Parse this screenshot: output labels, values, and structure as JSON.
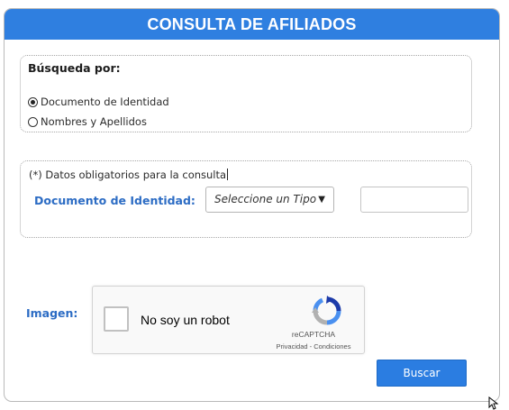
{
  "header": {
    "title": "CONSULTA DE AFILIADOS"
  },
  "search": {
    "legend": "Búsqueda por:",
    "options": [
      {
        "label": "Documento de Identidad",
        "checked": true
      },
      {
        "label": "Nombres y Apellidos",
        "checked": false
      }
    ]
  },
  "document": {
    "required_note": "(*) Datos obligatorios para la consulta",
    "label": "Documento de Identidad:",
    "type_select": {
      "value": "Seleccione un Tipo",
      "arrow": "▼"
    },
    "number_value": ""
  },
  "captcha": {
    "label": "Imagen:",
    "checkbox_text": "No soy un robot",
    "brand": "reCAPTCHA",
    "links": "Privacidad - Condiciones"
  },
  "actions": {
    "submit_label": "Buscar"
  },
  "colors": {
    "header_bg": "#2f7fe0",
    "label_blue": "#2c6cc4",
    "button_bg": "#2b7de1"
  }
}
